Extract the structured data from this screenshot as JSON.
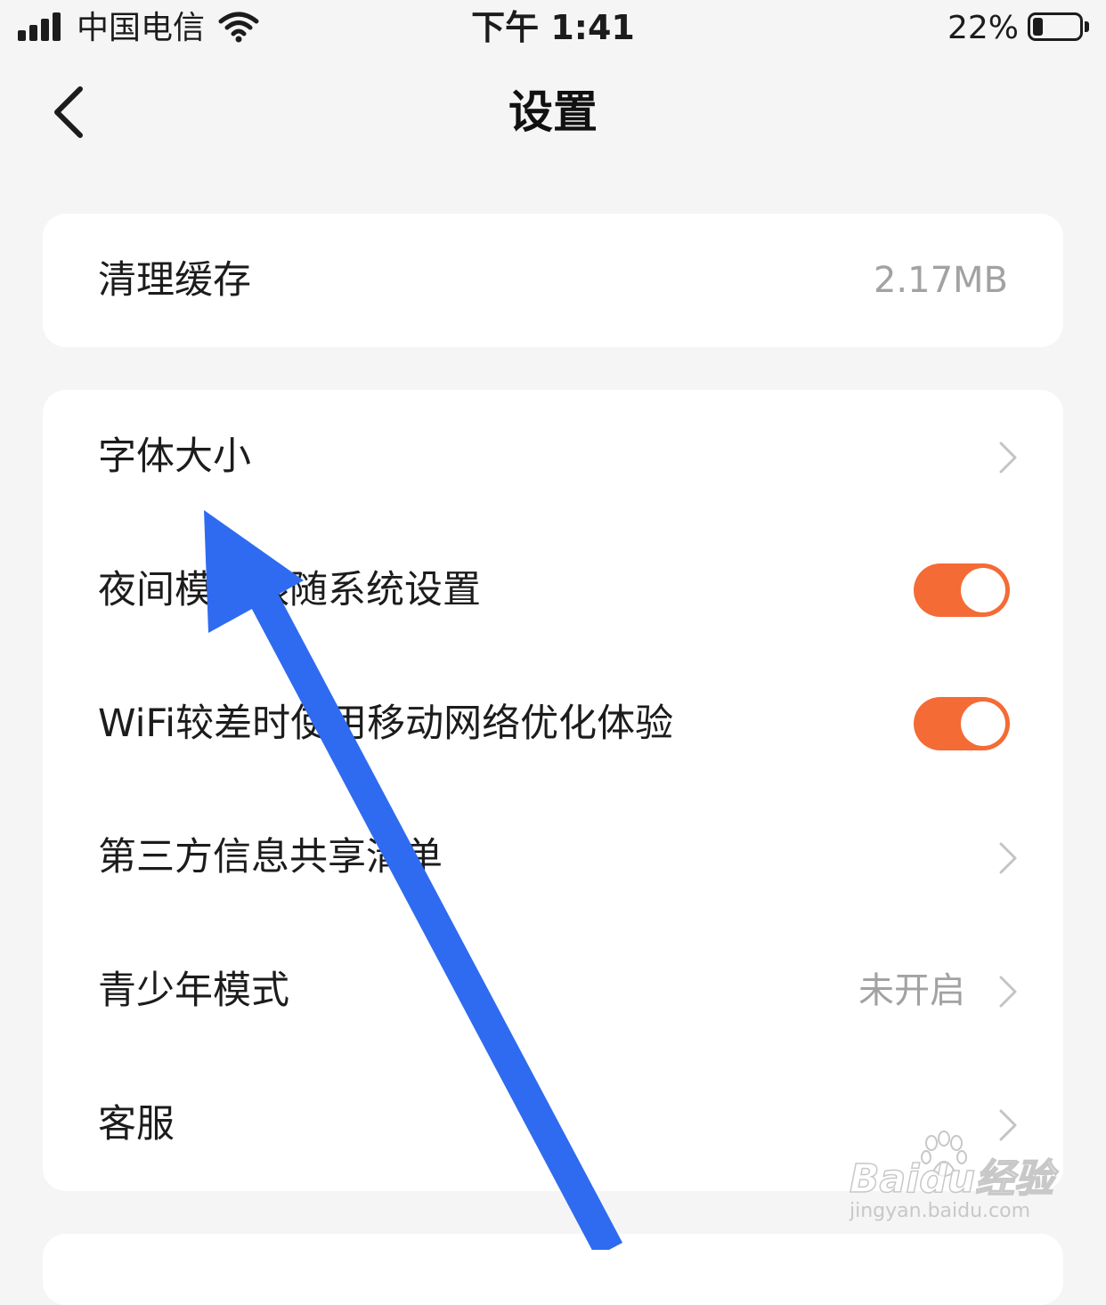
{
  "status_bar": {
    "carrier": "中国电信",
    "time": "下午 1:41",
    "battery_percent": "22%",
    "battery_level": 0.22,
    "signal_bars": 4
  },
  "nav": {
    "title": "设置",
    "back_icon": "chevron-left-icon"
  },
  "cache_card": {
    "label": "清理缓存",
    "value": "2.17MB"
  },
  "settings": {
    "font_size": {
      "label": "字体大小"
    },
    "night_mode": {
      "label": "夜间模式跟随系统设置",
      "enabled": true
    },
    "wifi_optimize": {
      "label": "WiFi较差时使用移动网络优化体验",
      "enabled": true
    },
    "third_party": {
      "label": "第三方信息共享清单"
    },
    "teen_mode": {
      "label": "青少年模式",
      "value": "未开启"
    },
    "customer_service": {
      "label": "客服"
    }
  },
  "colors": {
    "accent_toggle": "#f46b35",
    "annotation_arrow": "#2f6bf0",
    "background": "#f5f5f5"
  },
  "watermark": {
    "brand": "Baidu经验",
    "url": "jingyan.baidu.com"
  }
}
